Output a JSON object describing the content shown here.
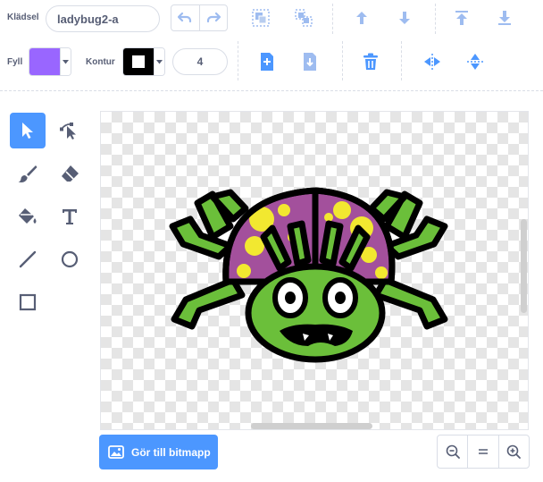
{
  "costume": {
    "name_label": "Klädsel",
    "name_value": "ladybug2-a"
  },
  "fill": {
    "label": "Fyll",
    "color": "#9966ff"
  },
  "outline": {
    "label": "Kontur",
    "color": "#000000",
    "width_value": "4"
  },
  "convert_button_label": "Gör till bitmapp",
  "colors": {
    "accent": "#4c97ff",
    "toolbar_icon": "#855cd6"
  },
  "icons": {
    "undo": "undo-icon",
    "redo": "redo-icon",
    "group": "group-icon",
    "ungroup": "ungroup-icon",
    "forward": "forward-icon",
    "backward": "backward-icon",
    "front": "front-icon",
    "back": "back-icon",
    "copy": "copy-icon",
    "paste": "paste-icon",
    "delete": "delete-icon",
    "flip_h": "flip-horizontal-icon",
    "flip_v": "flip-vertical-icon",
    "zoom_out": "zoom-out-icon",
    "zoom_reset": "zoom-reset-icon",
    "zoom_in": "zoom-in-icon"
  }
}
